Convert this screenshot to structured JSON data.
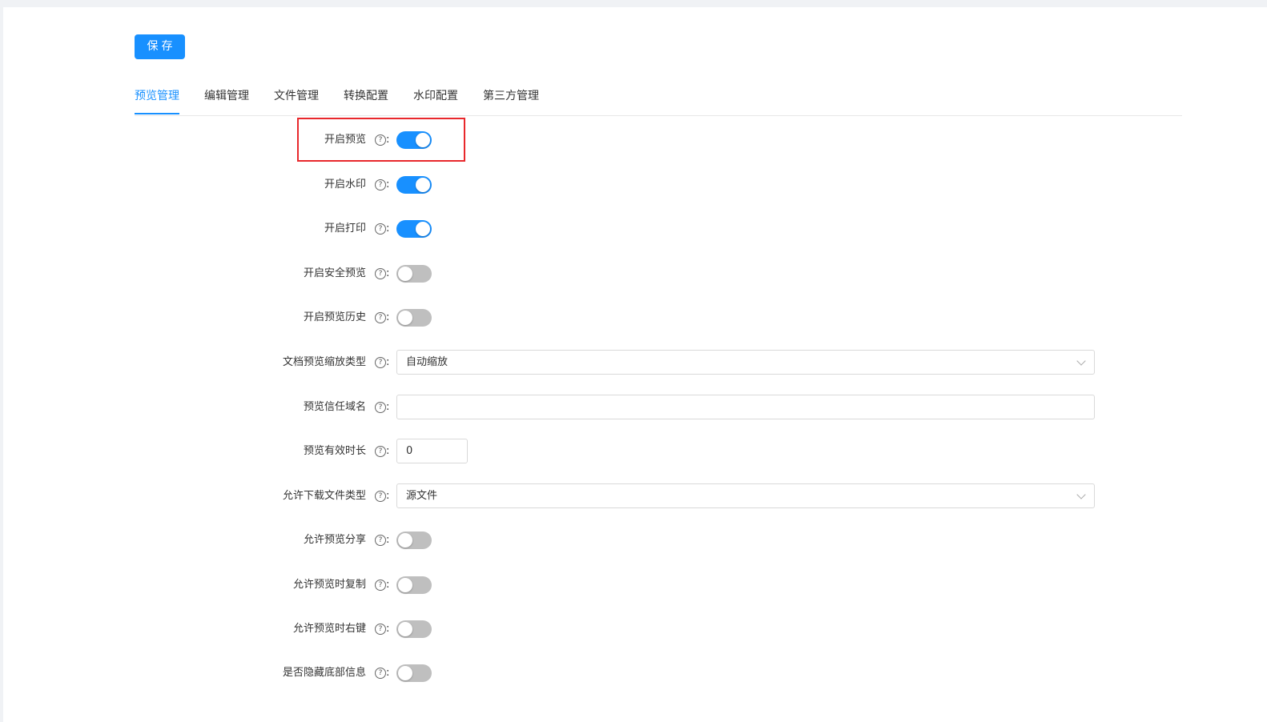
{
  "toolbar": {
    "save_label": "保存"
  },
  "tabs": [
    {
      "label": "预览管理",
      "active": true
    },
    {
      "label": "编辑管理",
      "active": false
    },
    {
      "label": "文件管理",
      "active": false
    },
    {
      "label": "转换配置",
      "active": false
    },
    {
      "label": "水印配置",
      "active": false
    },
    {
      "label": "第三方管理",
      "active": false
    }
  ],
  "form": {
    "help_icon": "question-circle-icon",
    "colon": ":",
    "enable_preview": {
      "label": "开启预览",
      "on": true
    },
    "enable_watermark": {
      "label": "开启水印",
      "on": true
    },
    "enable_print": {
      "label": "开启打印",
      "on": true
    },
    "enable_secure_preview": {
      "label": "开启安全预览",
      "on": false
    },
    "enable_preview_history": {
      "label": "开启预览历史",
      "on": false
    },
    "doc_zoom_type": {
      "label": "文档预览缩放类型",
      "value": "自动缩放"
    },
    "trusted_domain": {
      "label": "预览信任域名",
      "value": ""
    },
    "valid_duration": {
      "label": "预览有效时长",
      "value": "0"
    },
    "download_file_type": {
      "label": "允许下载文件类型",
      "value": "源文件"
    },
    "allow_share": {
      "label": "允许预览分享",
      "on": false
    },
    "allow_copy": {
      "label": "允许预览时复制",
      "on": false
    },
    "allow_right_click": {
      "label": "允许预览时右键",
      "on": false
    },
    "hide_footer_info": {
      "label": "是否隐藏底部信息",
      "on": false
    }
  },
  "colors": {
    "accent": "#1890ff",
    "switch_off": "#bfbfbf",
    "highlight": "#e8282c"
  }
}
